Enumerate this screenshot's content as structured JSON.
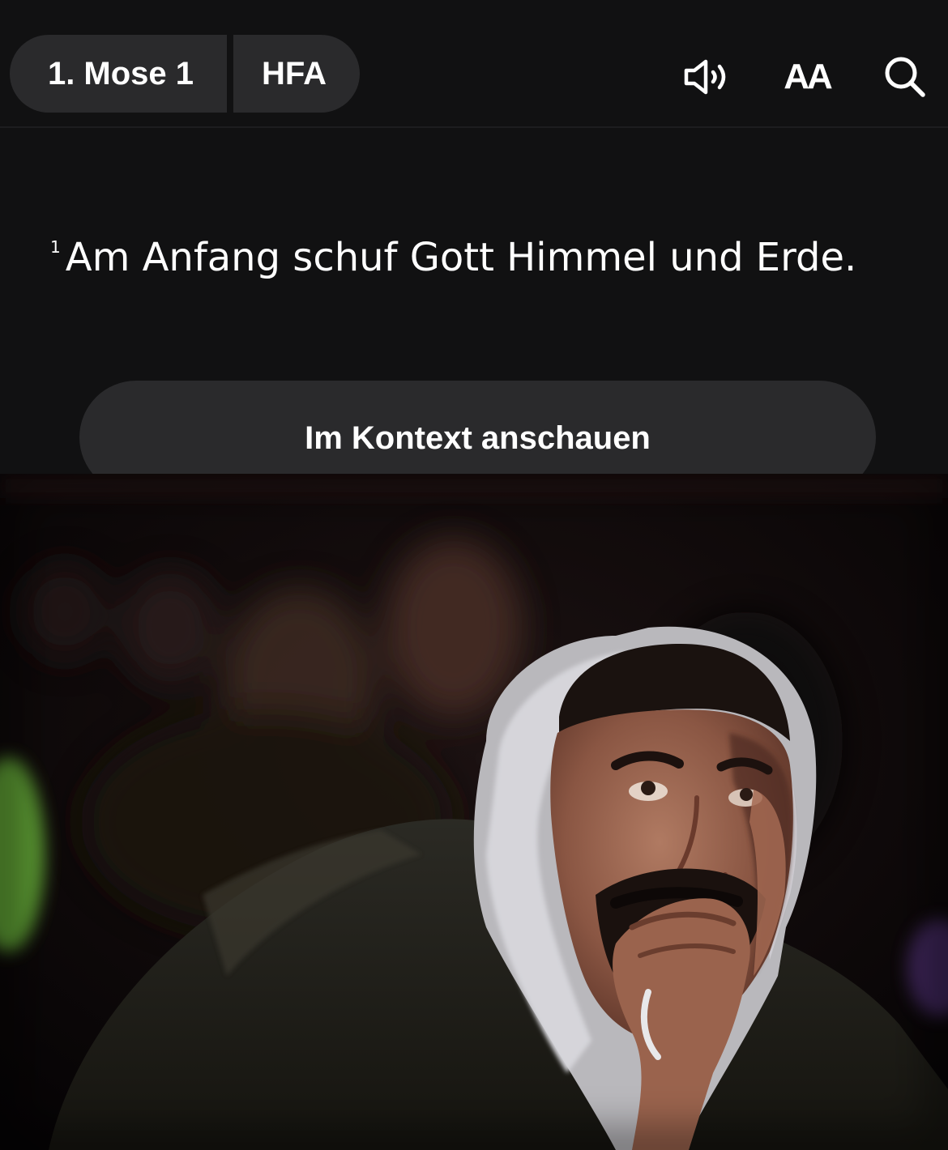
{
  "header": {
    "book_chapter": "1. Mose 1",
    "version": "HFA",
    "font_toggle": "AA"
  },
  "icons": {
    "audio": "speaker-icon",
    "font": "text-size-icon",
    "search": "search-icon"
  },
  "verse": {
    "number": "1",
    "text": "Am Anfang schuf Gott Himmel und Erde."
  },
  "context_button": {
    "label": "Im Kontext anschauen"
  },
  "colors": {
    "background": "#111112",
    "pill": "#2a2a2c",
    "text": "#ffffff"
  }
}
